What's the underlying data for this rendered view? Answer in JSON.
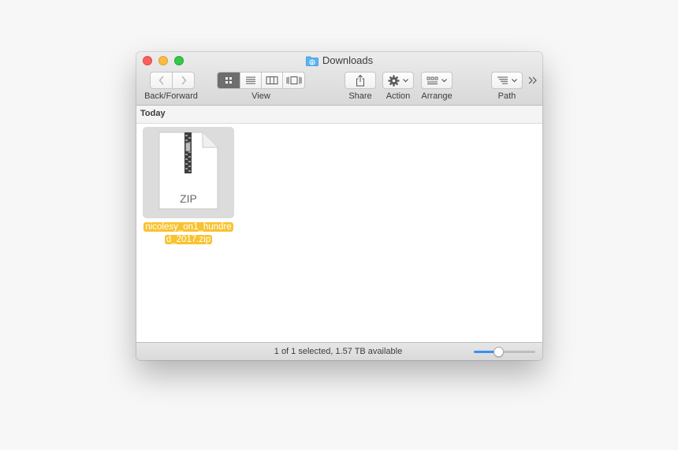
{
  "window": {
    "title": "Downloads",
    "title_icon": "downloads-folder-icon"
  },
  "toolbar": {
    "back_forward_label": "Back/Forward",
    "view_label": "View",
    "view_modes": [
      "icon-view",
      "list-view",
      "column-view",
      "cover-flow-view"
    ],
    "active_view": "icon-view",
    "share_label": "Share",
    "action_label": "Action",
    "arrange_label": "Arrange",
    "path_label": "Path",
    "overflow_icon": "chevron-double-right-icon"
  },
  "section": {
    "header": "Today"
  },
  "files": [
    {
      "icon_text": "ZIP",
      "name_line1": "nicolesy_on1_hundre",
      "name_line2": "d_2017.zip",
      "selected": true
    }
  ],
  "status": {
    "text": "1 of 1 selected, 1.57 TB available",
    "zoom_level": 0.4
  },
  "colors": {
    "close": "#fc605c",
    "minimize": "#fdbc40",
    "maximize": "#34c84a",
    "selection": "#f7c330",
    "slider_fill": "#3b8ff0",
    "folder": "#5ab4f0"
  }
}
